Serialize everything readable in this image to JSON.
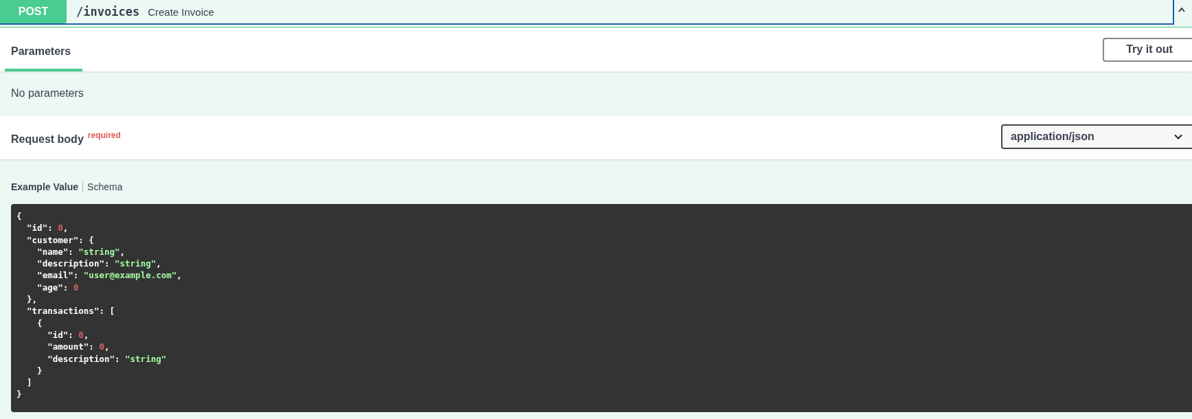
{
  "operation": {
    "method": "POST",
    "path": "/invoices",
    "summary": "Create Invoice"
  },
  "parameters": {
    "tabs": [
      {
        "label": "Parameters",
        "selected": true
      }
    ],
    "try_button": "Try it out",
    "message": "No parameters"
  },
  "request_body": {
    "title": "Request body",
    "required_label": "required",
    "content_type": "application/json"
  },
  "example_tabs": [
    {
      "label": "Example Value",
      "selected": true
    },
    {
      "label": "Schema",
      "selected": false
    }
  ],
  "code_lines": [
    [
      {
        "text": "{",
        "kind": "plain"
      }
    ],
    [
      {
        "text": "  \"id\": ",
        "kind": "plain"
      },
      {
        "text": "0",
        "kind": "number"
      },
      {
        "text": ",",
        "kind": "plain"
      }
    ],
    [
      {
        "text": "  \"customer\": {",
        "kind": "plain"
      }
    ],
    [
      {
        "text": "    \"name\": ",
        "kind": "plain"
      },
      {
        "text": "\"string\"",
        "kind": "string"
      },
      {
        "text": ",",
        "kind": "plain"
      }
    ],
    [
      {
        "text": "    \"description\": ",
        "kind": "plain"
      },
      {
        "text": "\"string\"",
        "kind": "string"
      },
      {
        "text": ",",
        "kind": "plain"
      }
    ],
    [
      {
        "text": "    \"email\": ",
        "kind": "plain"
      },
      {
        "text": "\"user@example.com\"",
        "kind": "string"
      },
      {
        "text": ",",
        "kind": "plain"
      }
    ],
    [
      {
        "text": "    \"age\": ",
        "kind": "plain"
      },
      {
        "text": "0",
        "kind": "number"
      }
    ],
    [
      {
        "text": "  },",
        "kind": "plain"
      }
    ],
    [
      {
        "text": "  \"transactions\": [",
        "kind": "plain"
      }
    ],
    [
      {
        "text": "    {",
        "kind": "plain"
      }
    ],
    [
      {
        "text": "      \"id\": ",
        "kind": "plain"
      },
      {
        "text": "0",
        "kind": "number"
      },
      {
        "text": ",",
        "kind": "plain"
      }
    ],
    [
      {
        "text": "      \"amount\": ",
        "kind": "plain"
      },
      {
        "text": "0",
        "kind": "number"
      },
      {
        "text": ",",
        "kind": "plain"
      }
    ],
    [
      {
        "text": "      \"description\": ",
        "kind": "plain"
      },
      {
        "text": "\"string\"",
        "kind": "string"
      }
    ],
    [
      {
        "text": "    }",
        "kind": "plain"
      }
    ],
    [
      {
        "text": "  ]",
        "kind": "plain"
      }
    ],
    [
      {
        "text": "}",
        "kind": "plain"
      }
    ]
  ]
}
